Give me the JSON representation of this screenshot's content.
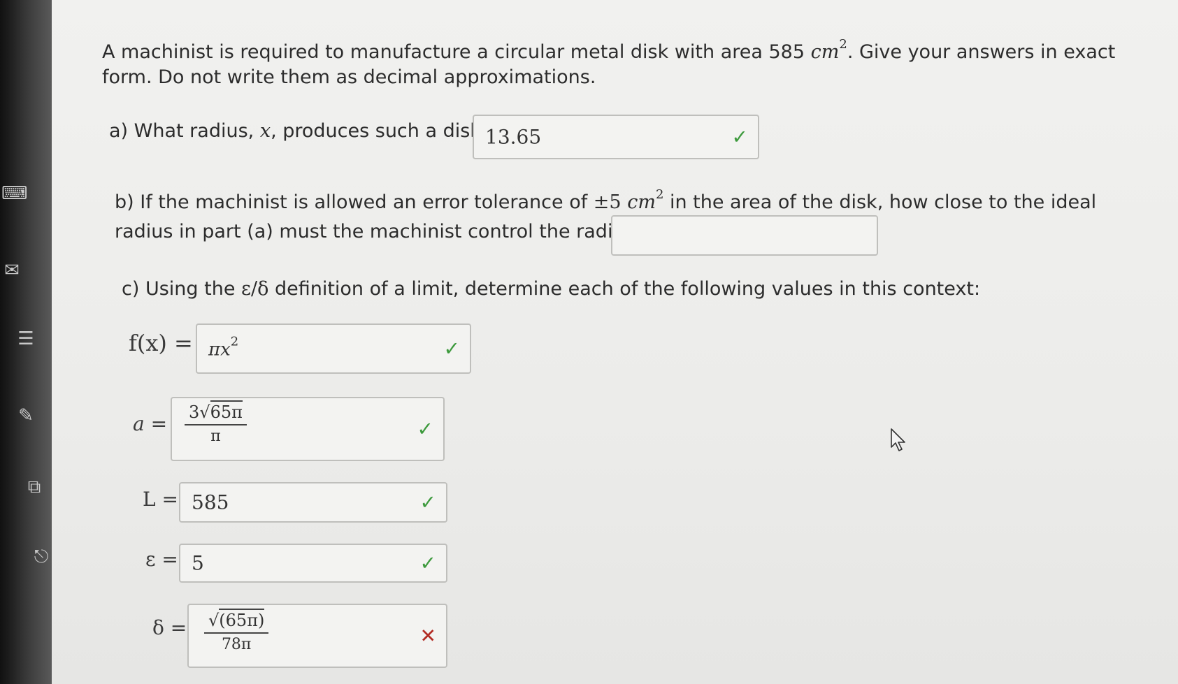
{
  "question": {
    "intro_line1_pre": "A machinist is required to manufacture a circular metal disk with area 585 ",
    "intro_unit": "cm",
    "intro_exp": "2",
    "intro_line1_post": ". Give your answers in exact",
    "intro_line2": "form. Do not write them as decimal approximations.",
    "part_a_pre": "a) What radius, ",
    "part_a_var": "x",
    "part_a_post": ", produces such a disk?",
    "part_b_line1_pre": "b) If the machinist is allowed an error tolerance of ",
    "part_b_tol": "±5",
    "part_b_unit": "cm",
    "part_b_exp": "2",
    "part_b_line1_post": " in the area of the disk, how close to the ideal",
    "part_b_line2": "radius in part (a) must the machinist control the radius?",
    "part_c_pre": "c) Using the ",
    "part_c_sym": "ε/δ",
    "part_c_post": " definition of a limit, determine each of the following values in this context:"
  },
  "answers": {
    "a_value": "13.65",
    "b_value": "",
    "f_label": "f(x) =",
    "f_value_base": "πx",
    "f_value_exp": "2",
    "a_label": "a =",
    "a_num_coef": "3",
    "a_num_root": "√",
    "a_num_radicand": "65π",
    "a_den": "π",
    "L_label": "L =",
    "L_value": "585",
    "eps_label": "ε =",
    "eps_value": "5",
    "delta_label": "δ =",
    "delta_num_root": "√",
    "delta_num_radicand": "(65π)",
    "delta_den": "78π"
  },
  "status": {
    "correct_icon": "checkmark-icon",
    "incorrect_icon": "cross-icon",
    "correct_color": "#3d9a3d",
    "incorrect_color": "#b22a22"
  }
}
